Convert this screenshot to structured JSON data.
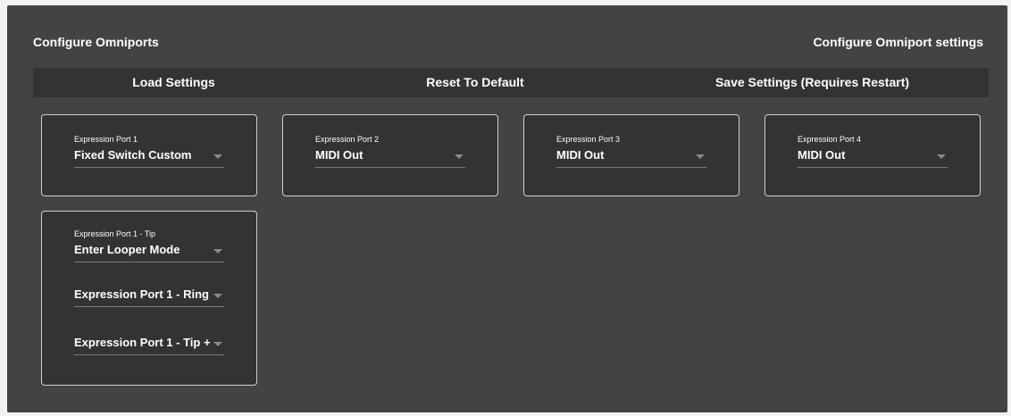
{
  "header": {
    "title": "Configure Omniports",
    "subtitle": "Configure Omniport settings"
  },
  "actions": {
    "load": "Load Settings",
    "reset": "Reset To Default",
    "save": "Save Settings (Requires Restart)"
  },
  "ports": [
    {
      "label": "Expression Port 1",
      "value": "Fixed Switch Custom"
    },
    {
      "label": "Expression Port 2",
      "value": "MIDI Out"
    },
    {
      "label": "Expression Port 3",
      "value": "MIDI Out"
    },
    {
      "label": "Expression Port 4",
      "value": "MIDI Out"
    }
  ],
  "port1_detail": {
    "tip_label": "Expression Port 1 - Tip",
    "tip_value": "Enter Looper Mode",
    "ring_value": "Expression Port 1 - Ring",
    "tipring_value": "Expression Port 1 - Tip +..."
  },
  "icons": {
    "dropdown": "chevron-down-icon"
  },
  "colors": {
    "panel": "#434343",
    "card": "#333333",
    "text": "#ffffff"
  }
}
